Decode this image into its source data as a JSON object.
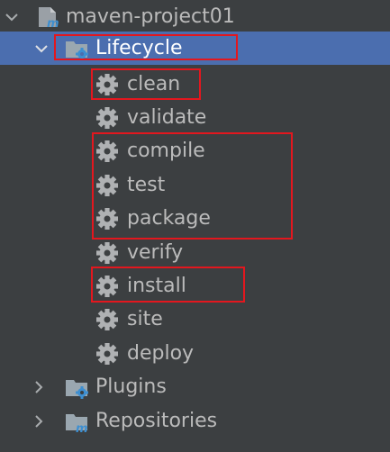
{
  "tree": {
    "root": {
      "label": "maven-project01",
      "icon": "maven-module-icon",
      "expanded": true
    },
    "lifecycle": {
      "label": "Lifecycle",
      "icon": "lifecycle-folder-icon",
      "expanded": true,
      "selected": true,
      "goals": [
        {
          "label": "clean",
          "icon": "gear-icon",
          "highlighted": true
        },
        {
          "label": "validate",
          "icon": "gear-icon",
          "highlighted": false
        },
        {
          "label": "compile",
          "icon": "gear-icon",
          "highlighted": true
        },
        {
          "label": "test",
          "icon": "gear-icon",
          "highlighted": true
        },
        {
          "label": "package",
          "icon": "gear-icon",
          "highlighted": true
        },
        {
          "label": "verify",
          "icon": "gear-icon",
          "highlighted": false
        },
        {
          "label": "install",
          "icon": "gear-icon",
          "highlighted": true
        },
        {
          "label": "site",
          "icon": "gear-icon",
          "highlighted": false
        },
        {
          "label": "deploy",
          "icon": "gear-icon",
          "highlighted": false
        }
      ]
    },
    "plugins": {
      "label": "Plugins",
      "icon": "plugins-folder-icon",
      "expanded": false
    },
    "repositories": {
      "label": "Repositories",
      "icon": "repositories-folder-icon",
      "expanded": false
    }
  },
  "colors": {
    "background": "#3c3f41",
    "selection": "#4b6eaf",
    "text": "#bbbbbb",
    "highlight_box": "#e3171e",
    "gear": "#afb1b3",
    "maven_blue": "#3d8fd1"
  }
}
